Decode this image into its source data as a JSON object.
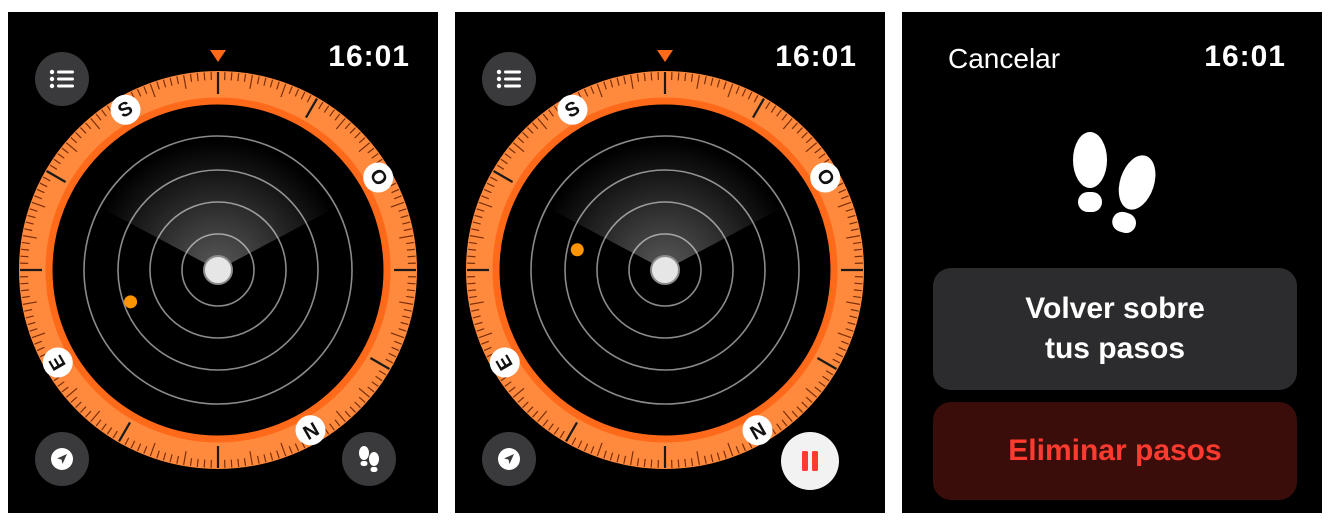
{
  "colors": {
    "accent_orange": "#ff6a1a",
    "dial_orange": "#ff8a3d",
    "waypoint_orange": "#ff9500",
    "destructive_red": "#ff3b30",
    "button_gray": "#3a3a3c",
    "background": "#000000"
  },
  "screens": [
    {
      "time": "16:01",
      "cardinals": [
        "N",
        "E",
        "S",
        "O"
      ],
      "buttons": {
        "menu_icon": "list-icon",
        "location_icon": "location-arrow-icon",
        "secondary_icon": "footsteps-icon"
      },
      "waypoint": {
        "heading_deg": 250,
        "distance": 0.62
      }
    },
    {
      "time": "16:01",
      "cardinals": [
        "N",
        "E",
        "S",
        "O"
      ],
      "buttons": {
        "menu_icon": "list-icon",
        "location_icon": "location-arrow-icon",
        "secondary_icon": "pause-icon"
      },
      "waypoint": {
        "heading_deg": 283,
        "distance": 0.6
      }
    },
    {
      "time": "16:01",
      "cancel_label": "Cancelar",
      "icon": "footsteps-icon",
      "primary_button_line1": "Volver sobre",
      "primary_button_line2": "tus pasos",
      "delete_button_label": "Eliminar pasos"
    }
  ]
}
